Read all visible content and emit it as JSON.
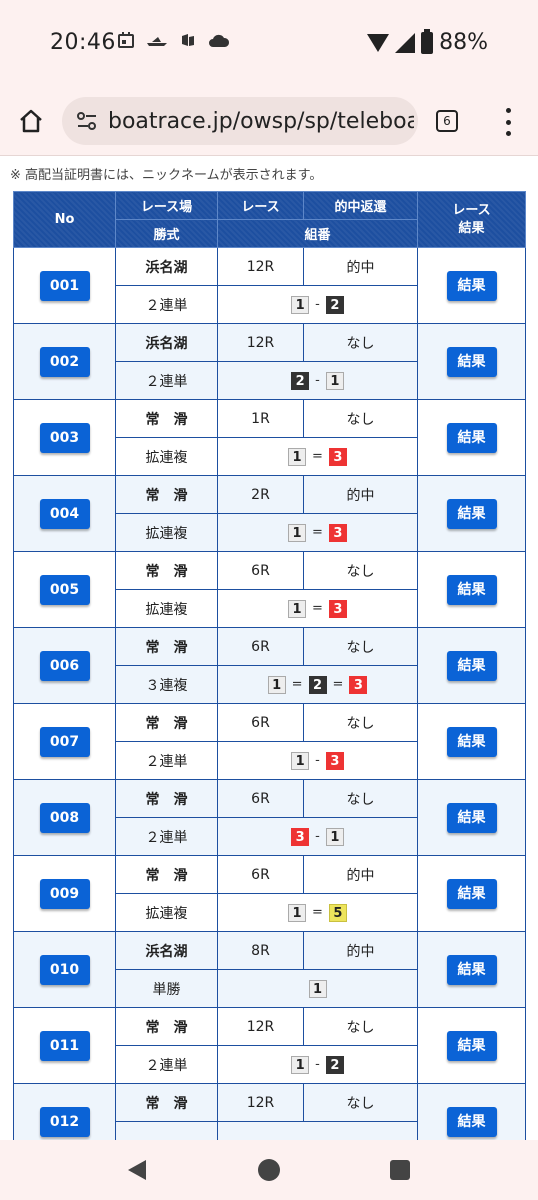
{
  "status": {
    "time": "20:46",
    "battery": "88%",
    "icons_left": [
      "calendar-icon",
      "boat-icon",
      "boat-icon",
      "cloud-icon"
    ]
  },
  "browser": {
    "url": "boatrace.jp/owsp/sp/teleboat",
    "tab_count": "6"
  },
  "note": "※ 高配当証明書には、ニックネームが表示されます。",
  "table": {
    "headers": {
      "no": "No",
      "venue": "レース場",
      "race": "レース",
      "hit": "的中返還",
      "bet_type": "勝式",
      "combo": "組番",
      "result": "レース結果"
    },
    "result_label": "結果",
    "rows": [
      {
        "no": "001",
        "venue": "浜名湖",
        "race": "12R",
        "hit": "的中",
        "bet_type": "２連単",
        "combo": [
          "1",
          "-",
          "2"
        ]
      },
      {
        "no": "002",
        "venue": "浜名湖",
        "race": "12R",
        "hit": "なし",
        "bet_type": "２連単",
        "combo": [
          "2",
          "-",
          "1"
        ]
      },
      {
        "no": "003",
        "venue": "常　滑",
        "race": "1R",
        "hit": "なし",
        "bet_type": "拡連複",
        "combo": [
          "1",
          "=",
          "3"
        ]
      },
      {
        "no": "004",
        "venue": "常　滑",
        "race": "2R",
        "hit": "的中",
        "bet_type": "拡連複",
        "combo": [
          "1",
          "=",
          "3"
        ]
      },
      {
        "no": "005",
        "venue": "常　滑",
        "race": "6R",
        "hit": "なし",
        "bet_type": "拡連複",
        "combo": [
          "1",
          "=",
          "3"
        ]
      },
      {
        "no": "006",
        "venue": "常　滑",
        "race": "6R",
        "hit": "なし",
        "bet_type": "３連複",
        "combo": [
          "1",
          "=",
          "2",
          "=",
          "3"
        ]
      },
      {
        "no": "007",
        "venue": "常　滑",
        "race": "6R",
        "hit": "なし",
        "bet_type": "２連単",
        "combo": [
          "1",
          "-",
          "3"
        ]
      },
      {
        "no": "008",
        "venue": "常　滑",
        "race": "6R",
        "hit": "なし",
        "bet_type": "２連単",
        "combo": [
          "3",
          "-",
          "1"
        ]
      },
      {
        "no": "009",
        "venue": "常　滑",
        "race": "6R",
        "hit": "的中",
        "bet_type": "拡連複",
        "combo": [
          "1",
          "=",
          "5"
        ]
      },
      {
        "no": "010",
        "venue": "浜名湖",
        "race": "8R",
        "hit": "的中",
        "bet_type": "単勝",
        "combo": [
          "1"
        ]
      },
      {
        "no": "011",
        "venue": "常　滑",
        "race": "12R",
        "hit": "なし",
        "bet_type": "２連単",
        "combo": [
          "1",
          "-",
          "2"
        ]
      },
      {
        "no": "012",
        "venue": "常　滑",
        "race": "12R",
        "hit": "なし",
        "bet_type": "",
        "combo": []
      }
    ]
  },
  "colors": {
    "header_blue": "#1d4fa0",
    "button_blue": "#0b63d6",
    "boat_1": "#eeeeee",
    "boat_2": "#333333",
    "boat_3": "#ee3333",
    "boat_5": "#ede45c"
  }
}
